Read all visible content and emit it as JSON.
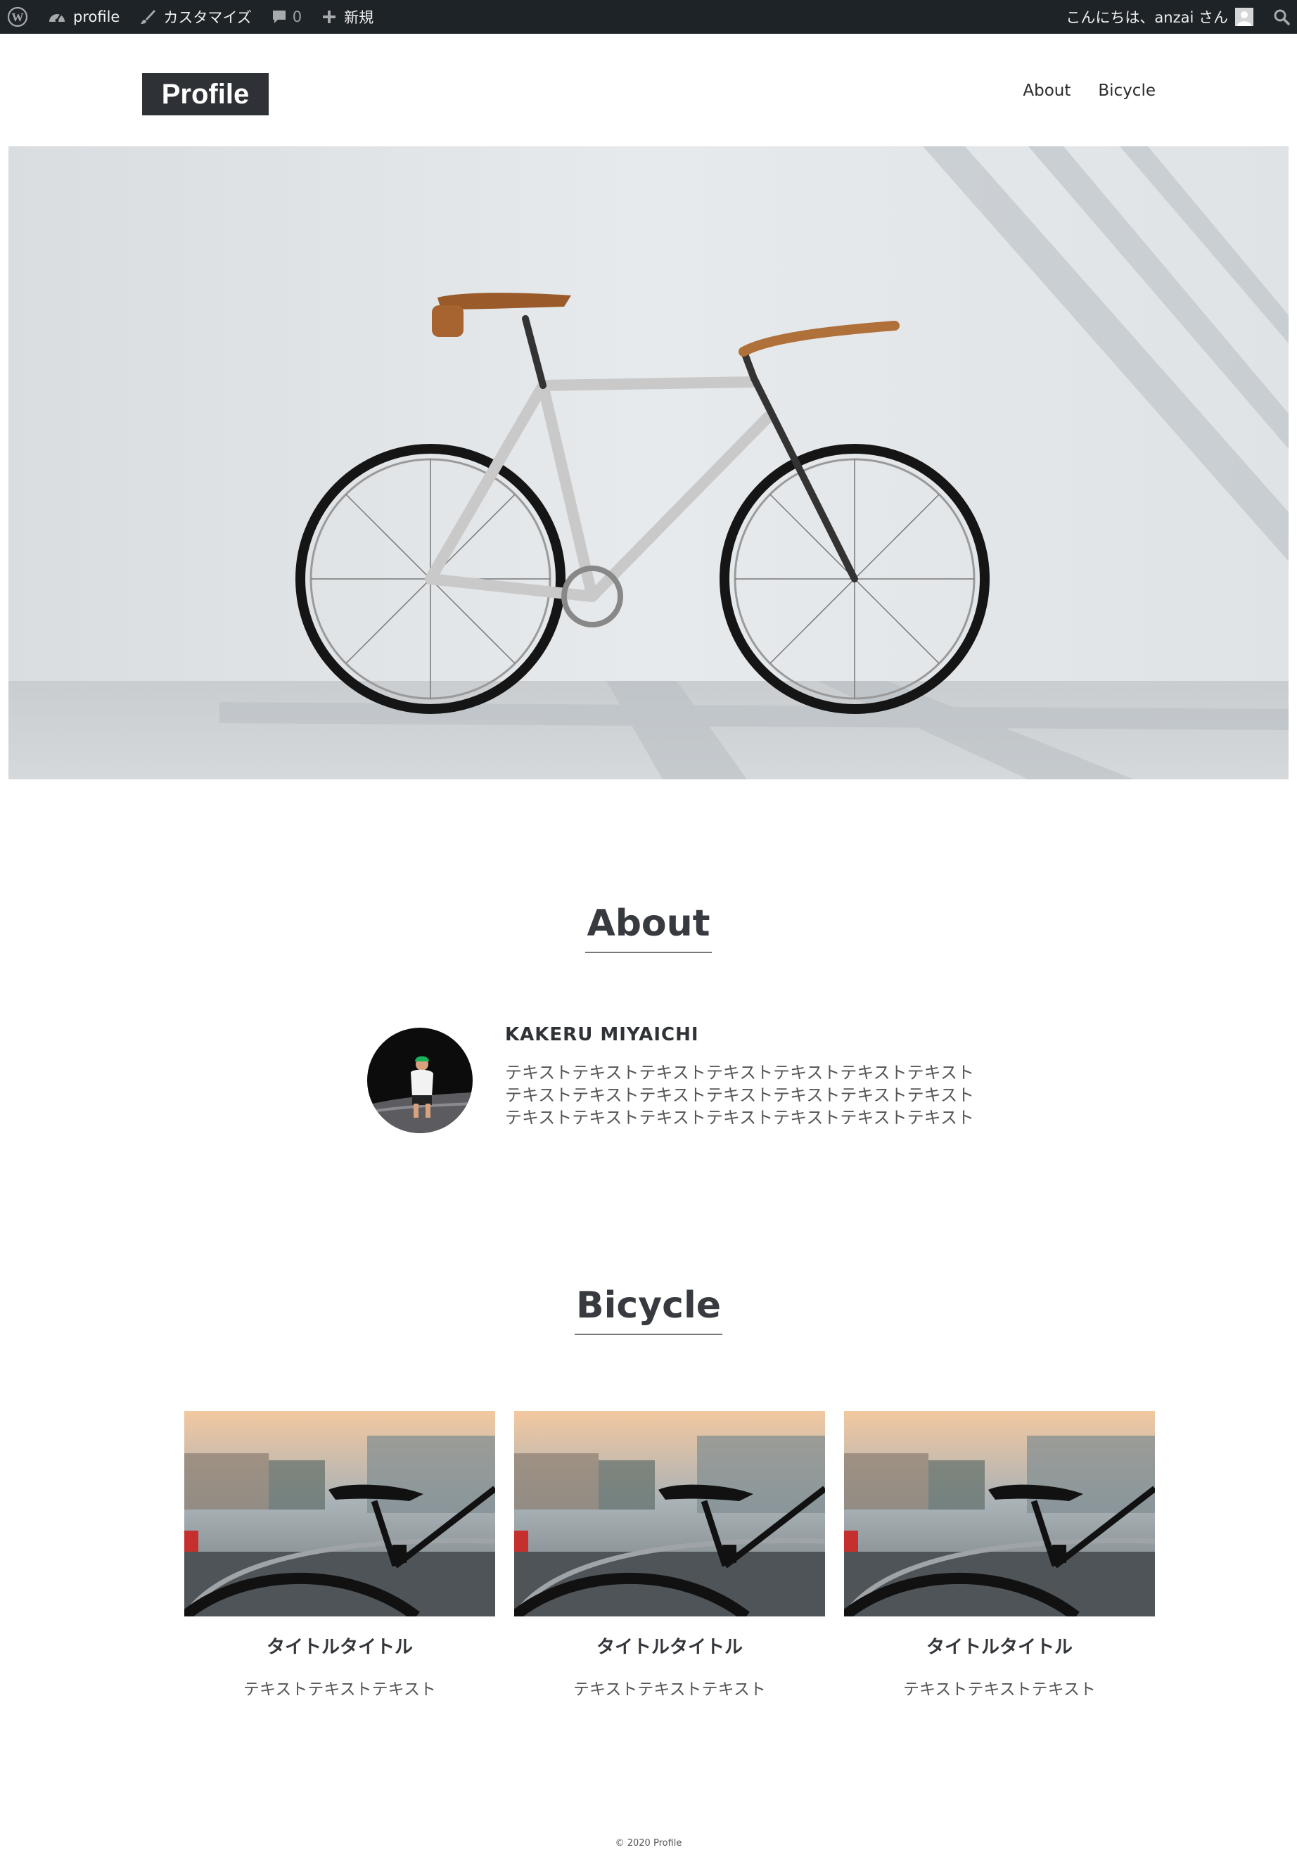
{
  "admin_bar": {
    "site_name": "profile",
    "customize_label": "カスタマイズ",
    "comment_count": "0",
    "new_label": "新規",
    "greeting": "こんにちは、anzai さん"
  },
  "header": {
    "logo": "Profile",
    "nav": [
      "About",
      "Bicycle"
    ]
  },
  "about": {
    "title": "About",
    "name": "KAKERU MIYAICHI",
    "text_lines": [
      "テキストテキストテキストテキストテキストテキストテキスト",
      "テキストテキストテキストテキストテキストテキストテキスト",
      "テキストテキストテキストテキストテキストテキストテキスト"
    ]
  },
  "bicycle": {
    "title": "Bicycle",
    "cards": [
      {
        "title": "タイトルタイトル",
        "text": "テキストテキストテキスト"
      },
      {
        "title": "タイトルタイトル",
        "text": "テキストテキストテキスト"
      },
      {
        "title": "タイトルタイトル",
        "text": "テキストテキストテキスト"
      }
    ]
  },
  "footer": {
    "copyright": "© 2020 Profile"
  },
  "icons": [
    "wordpress-icon",
    "dashboard-icon",
    "brush-icon",
    "comment-icon",
    "plus-icon",
    "search-icon"
  ],
  "colors": {
    "admin_bar_bg": "#1d2327",
    "logo_bg": "#2e3136",
    "heading": "#373a3f"
  }
}
